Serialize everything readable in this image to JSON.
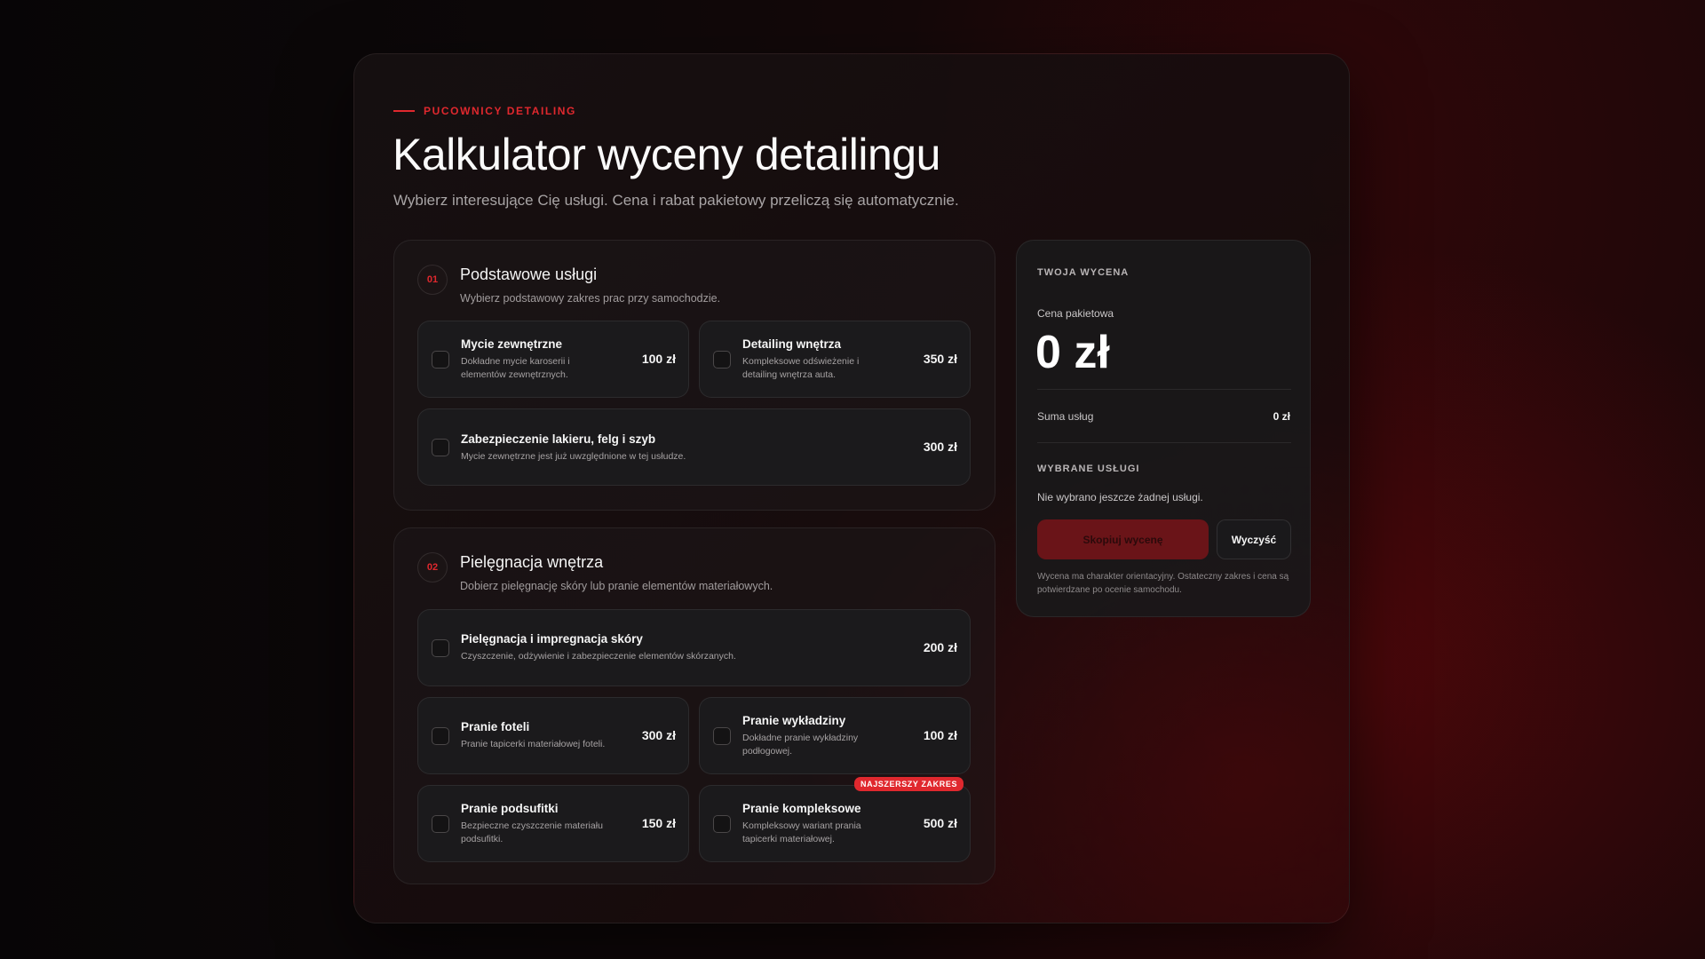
{
  "header": {
    "eyebrow": "PUCOWNICY DETAILING",
    "title": "Kalkulator wyceny detailingu",
    "subtitle": "Wybierz interesujące Cię usługi. Cena i rabat pakietowy przeliczą się automatycznie."
  },
  "sections": [
    {
      "number": "01",
      "title": "Podstawowe usługi",
      "description": "Wybierz podstawowy zakres prac przy samochodzie.",
      "services": [
        {
          "title": "Mycie zewnętrzne",
          "description": "Dokładne mycie karoserii i elementów zewnętrznych.",
          "price": "100 zł",
          "checked": false
        },
        {
          "title": "Detailing wnętrza",
          "description": "Kompleksowe odświeżenie i detailing wnętrza auta.",
          "price": "350 zł",
          "checked": false
        },
        {
          "title": "Zabezpieczenie lakieru, felg i szyb",
          "description": "Mycie zewnętrzne jest już uwzględnione w tej usłudze.",
          "price": "300 zł",
          "checked": false
        }
      ]
    },
    {
      "number": "02",
      "title": "Pielęgnacja wnętrza",
      "description": "Dobierz pielęgnację skóry lub pranie elementów materiałowych.",
      "services": [
        {
          "title": "Pielęgnacja i impregnacja skóry",
          "description": "Czyszczenie, odżywienie i zabezpieczenie elementów skórzanych.",
          "price": "200 zł",
          "checked": false
        },
        {
          "title": "Pranie foteli",
          "description": "Pranie tapicerki materiałowej foteli.",
          "price": "300 zł",
          "checked": false
        },
        {
          "title": "Pranie wykładziny",
          "description": "Dokładne pranie wykładziny podłogowej.",
          "price": "100 zł",
          "checked": false
        },
        {
          "title": "Pranie podsufitki",
          "description": "Bezpieczne czyszczenie materiału podsufitki.",
          "price": "150 zł",
          "checked": false
        },
        {
          "title": "Pranie kompleksowe",
          "description": "Kompleksowy wariant prania tapicerki materiałowej.",
          "price": "500 zł",
          "checked": false,
          "badge": "NAJSZERSZY ZAKRES"
        }
      ]
    }
  ],
  "summary": {
    "heading": "TWOJA WYCENA",
    "package_label": "Cena pakietowa",
    "package_total": "0 zł",
    "sum_label": "Suma usług",
    "sum_value": "0 zł",
    "selected_heading": "WYBRANE USŁUGI",
    "selected_empty": "Nie wybrano jeszcze żadnej usługi.",
    "copy_button": "Skopiuj wycenę",
    "clear_button": "Wyczyść",
    "note": "Wycena ma charakter orientacyjny. Ostateczny zakres i cena są potwierdzane po ocenie samochodu."
  },
  "colors": {
    "accent": "#e0282e",
    "card": "#1b1a1c",
    "copy_button_bg": "#6a1418"
  }
}
